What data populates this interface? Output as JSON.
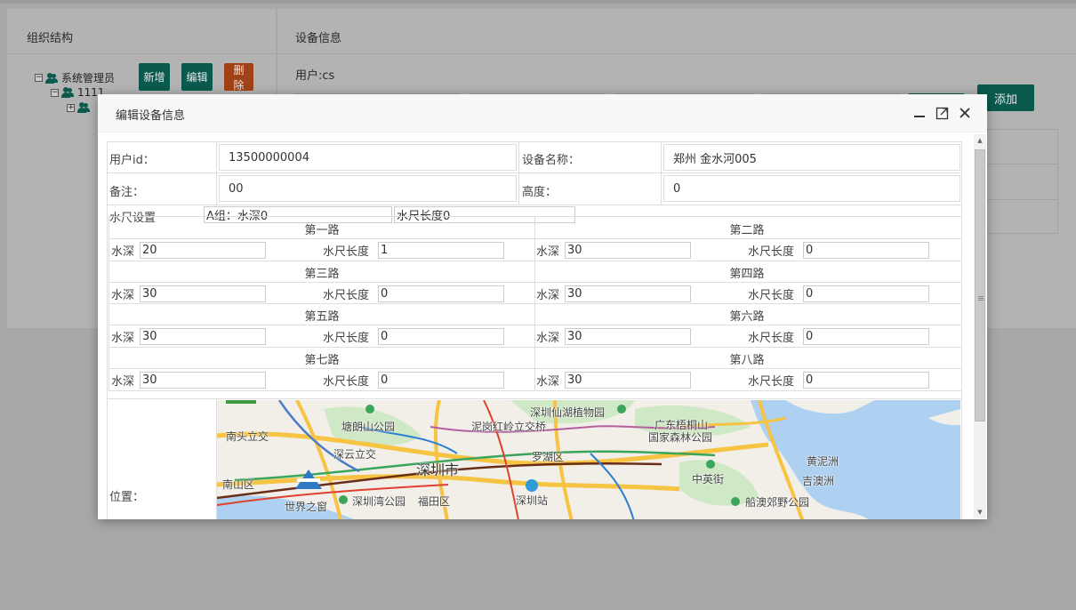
{
  "background": {
    "left_panel_title": "组织结构",
    "right_panel_title": "设备信息",
    "tree": {
      "root": "系统管理员",
      "child": "1111"
    },
    "buttons": {
      "add": "新增",
      "edit": "编辑",
      "delete": "删除",
      "add_device": "添加"
    },
    "user_label": "用户:cs"
  },
  "modal": {
    "title": "编辑设备信息",
    "fields": {
      "user_id_label": "用户id：",
      "user_id_value": "13500000004",
      "device_name_label": "设备名称：",
      "device_name_value": "郑州 金水河005",
      "remark_label": "备注：",
      "remark_value": "00",
      "height_label": "高度：",
      "height_value": "0"
    },
    "water_gauge": {
      "label": "水尺设置",
      "group_a_depth": "A组：水深0",
      "group_a_length": "水尺长度0",
      "depth_label": "水深",
      "length_label": "水尺长度",
      "routes": [
        {
          "name": "第一路",
          "depth": "20",
          "length": "1"
        },
        {
          "name": "第二路",
          "depth": "30",
          "length": "0"
        },
        {
          "name": "第三路",
          "depth": "30",
          "length": "0"
        },
        {
          "name": "第四路",
          "depth": "30",
          "length": "0"
        },
        {
          "name": "第五路",
          "depth": "30",
          "length": "0"
        },
        {
          "name": "第六路",
          "depth": "30",
          "length": "0"
        },
        {
          "name": "第七路",
          "depth": "30",
          "length": "0"
        },
        {
          "name": "第八路",
          "depth": "30",
          "length": "0"
        }
      ]
    },
    "location_label": "位置：",
    "map_labels": {
      "nantou": "南头立交",
      "tanglang": "塘朗山公园",
      "nigang": "泥岗红岭立交桥",
      "xianhu": "深圳仙湖植物园",
      "wutong": "广东梧桐山",
      "wutong2": "国家森林公园",
      "shenyun": "深云立交",
      "luohu": "罗湖区",
      "shenzhen": "深圳市",
      "nanshan": "南山区",
      "zhongying": "中英街",
      "huangni": "黄泥洲",
      "jiao": "吉澳洲",
      "shijie": "世界之窗",
      "wanpark": "深圳湾公园",
      "futian": "福田区",
      "station": "深圳站",
      "chuannao": "船澳郊野公园"
    }
  }
}
